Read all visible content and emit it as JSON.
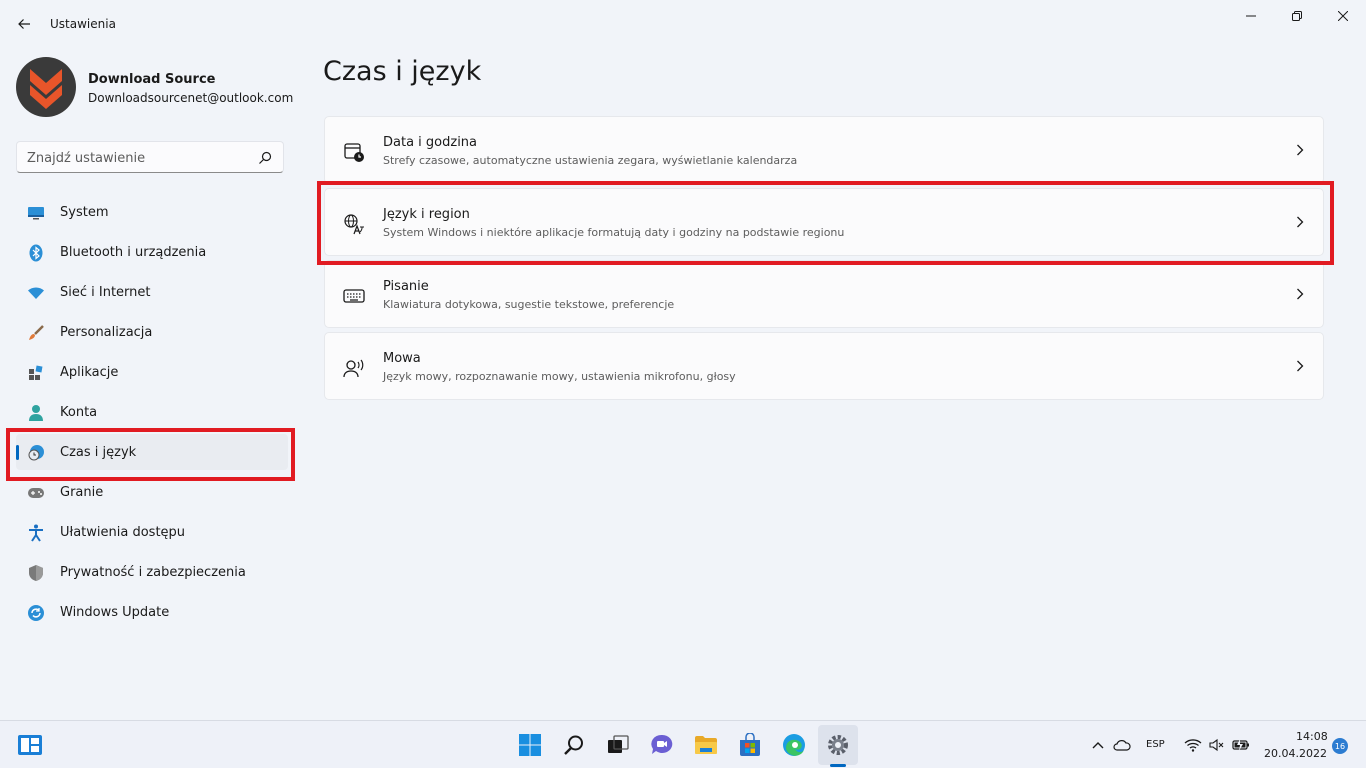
{
  "app": {
    "title": "Ustawienia"
  },
  "profile": {
    "name": "Download Source",
    "email": "Downloadsourcenet@outlook.com"
  },
  "search": {
    "placeholder": "Znajdź ustawienie"
  },
  "sidebar": {
    "items": [
      {
        "label": "System",
        "icon": "monitor-icon"
      },
      {
        "label": "Bluetooth i urządzenia",
        "icon": "bluetooth-icon"
      },
      {
        "label": "Sieć i Internet",
        "icon": "wifi-icon"
      },
      {
        "label": "Personalizacja",
        "icon": "brush-icon"
      },
      {
        "label": "Aplikacje",
        "icon": "apps-icon"
      },
      {
        "label": "Konta",
        "icon": "person-icon"
      },
      {
        "label": "Czas i język",
        "icon": "clock-globe-icon",
        "active": true
      },
      {
        "label": "Granie",
        "icon": "gamepad-icon"
      },
      {
        "label": "Ułatwienia dostępu",
        "icon": "accessibility-icon"
      },
      {
        "label": "Prywatność i zabezpieczenia",
        "icon": "shield-icon"
      },
      {
        "label": "Windows Update",
        "icon": "update-icon"
      }
    ]
  },
  "main": {
    "title": "Czas i język",
    "cards": [
      {
        "title": "Data i godzina",
        "desc": "Strefy czasowe, automatyczne ustawienia zegara, wyświetlanie kalendarza",
        "icon": "calendar-clock-icon"
      },
      {
        "title": "Język i region",
        "desc": "System Windows i niektóre aplikacje formatują daty i godziny na podstawie regionu",
        "icon": "language-icon"
      },
      {
        "title": "Pisanie",
        "desc": "Klawiatura dotykowa, sugestie tekstowe, preferencje",
        "icon": "keyboard-icon"
      },
      {
        "title": "Mowa",
        "desc": "Język mowy, rozpoznawanie mowy, ustawienia mikrofonu, głosy",
        "icon": "speech-icon"
      }
    ]
  },
  "taskbar": {
    "language": "ESP",
    "time": "14:08",
    "date": "20.04.2022",
    "notifications": "16"
  },
  "colors": {
    "accent": "#0067c0",
    "highlight": "#e11b22",
    "background": "#f1f4f9"
  }
}
